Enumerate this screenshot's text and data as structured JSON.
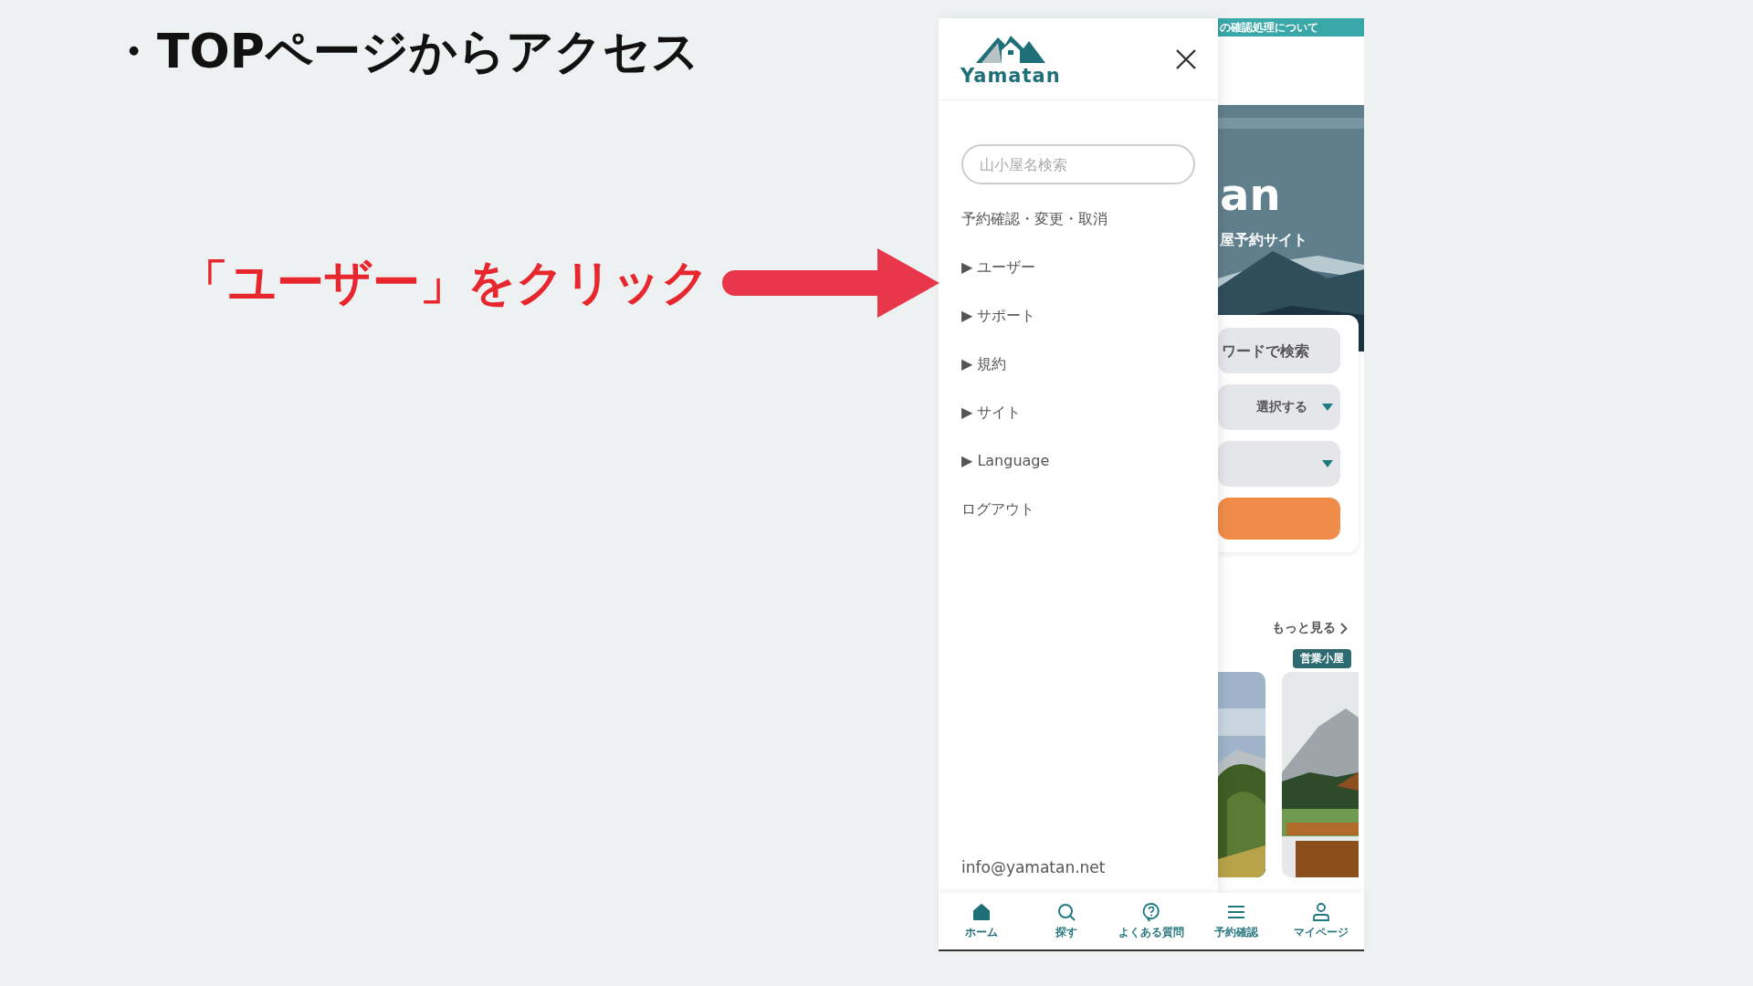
{
  "heading": "・TOPページからアクセス",
  "callout": "「ユーザー」をクリック",
  "drawer": {
    "logo": "Yamatan",
    "search": {
      "placeholder": "山小屋名検索"
    },
    "menu": [
      {
        "label": "予約確認・変更・取消"
      },
      {
        "marker": "▶",
        "label": "ユーザー"
      },
      {
        "marker": "▶",
        "label": "サポート"
      },
      {
        "marker": "▶",
        "label": "規約"
      },
      {
        "marker": "▶",
        "label": "サイト"
      },
      {
        "marker": "▶",
        "label": "Language"
      },
      {
        "label": "ログアウト"
      }
    ],
    "email": "info@yamatan.net"
  },
  "page": {
    "banner": "の確認処理について",
    "hero": {
      "title": "an",
      "subtitle": "屋予約サイト"
    },
    "keyword_field": {
      "placeholder": "ワードで検索"
    },
    "select": {
      "value": "選択する"
    },
    "more_link": "もっと見る",
    "badge": "営業小屋"
  },
  "bottom_nav": [
    {
      "label": "ホーム",
      "selected": true
    },
    {
      "label": "探す",
      "selected": false
    },
    {
      "label": "よくある質問",
      "selected": false
    },
    {
      "label": "予約確認",
      "selected": false
    },
    {
      "label": "マイページ",
      "selected": false
    }
  ]
}
